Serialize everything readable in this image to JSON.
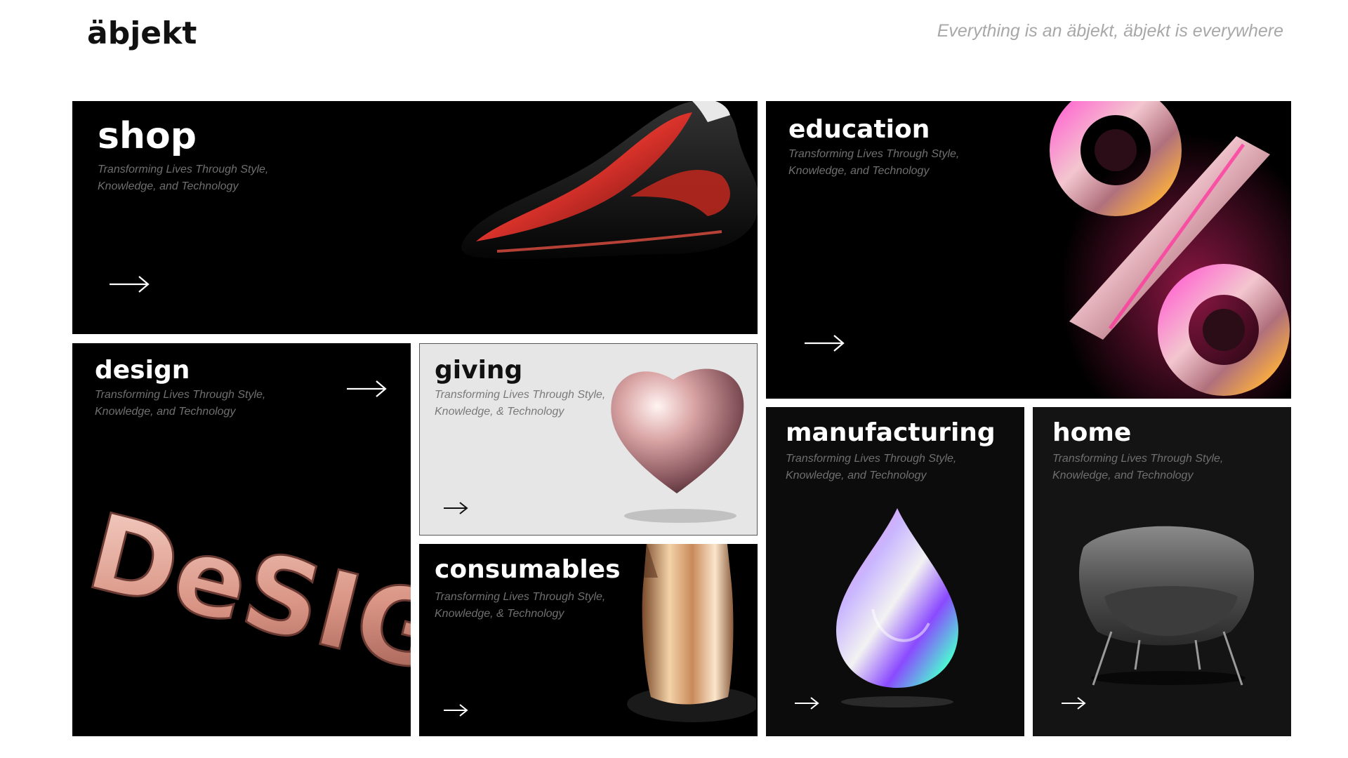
{
  "header": {
    "logo": "äbjekt",
    "tagline": "Everything is an äbjekt, äbjekt is everywhere"
  },
  "tiles": {
    "shop": {
      "title": "shop",
      "subtitle": "Transforming Lives Through Style, Knowledge, and Technology",
      "image": "shoe-image"
    },
    "education": {
      "title": "education",
      "subtitle": "Transforming Lives Through Style, Knowledge, and Technology",
      "image": "percent-symbol-image"
    },
    "design": {
      "title": "design",
      "subtitle": "Transforming Lives Through Style, Knowledge, and Technology",
      "image": "design-letters-image",
      "art_text": "DeSIGN"
    },
    "giving": {
      "title": "giving",
      "subtitle": "Transforming Lives Through Style, Knowledge, & Technology",
      "image": "heart-image"
    },
    "consumables": {
      "title": "consumables",
      "subtitle": "Transforming Lives Through Style, Knowledge, & Technology",
      "image": "coffee-bag-image"
    },
    "manufacturing": {
      "title": "manufacturing",
      "subtitle": "Transforming Lives Through Style, Knowledge, and Technology",
      "image": "iridescent-drop-image"
    },
    "home": {
      "title": "home",
      "subtitle": "Transforming Lives Through Style, Knowledge, and Technology",
      "image": "armchair-image"
    }
  },
  "icons": {
    "arrow": "arrow-right-icon"
  },
  "colors": {
    "tile_dark": "#000000",
    "tile_light": "#e6e6e6",
    "rose_gold": "#e0a89a",
    "accent_pink": "#ff3aa0"
  }
}
